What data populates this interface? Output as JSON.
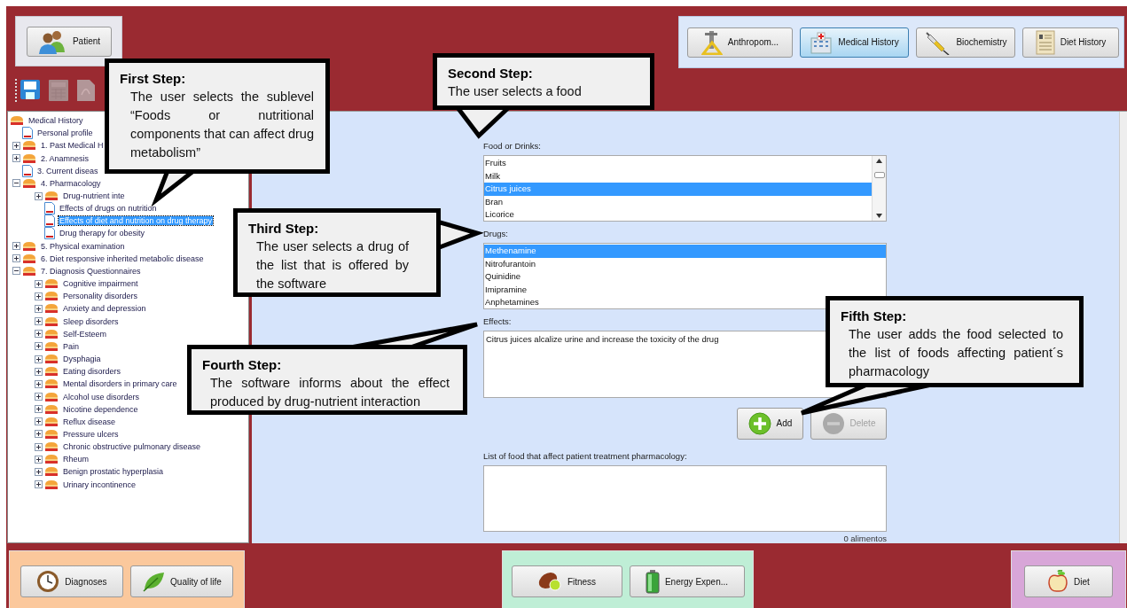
{
  "patient_panel": {
    "button": {
      "label": "Patient",
      "kind": "people"
    }
  },
  "toolbar": [
    {
      "kind": "save",
      "disabled": false
    },
    {
      "kind": "calculator",
      "disabled": true
    },
    {
      "kind": "pdf",
      "disabled": true
    }
  ],
  "nav_tabs": [
    {
      "label": "Anthropom...",
      "kind": "caliper",
      "selected": false
    },
    {
      "label": "Medical History",
      "kind": "hospital",
      "selected": true
    },
    {
      "label": "Biochemistry",
      "kind": "syringe",
      "selected": false
    },
    {
      "label": "Diet History",
      "kind": "document",
      "selected": false
    }
  ],
  "tree": {
    "label": "Medical History",
    "kind": "folder",
    "selected": false,
    "children": [
      {
        "label": "Personal profile",
        "kind": "doc",
        "selected": false
      },
      {
        "label": "1. Past Medical H",
        "kind": "folder",
        "expanded": false,
        "selected": false
      },
      {
        "label": "2. Anamnesis",
        "kind": "folder",
        "expanded": false,
        "selected": false
      },
      {
        "label": "3. Current diseas",
        "kind": "doc",
        "selected": false
      },
      {
        "label": "4. Pharmacology",
        "kind": "folder",
        "expanded": true,
        "selected": false,
        "children": [
          {
            "label": "Drug-nutrient inte",
            "kind": "folder",
            "expanded": false,
            "selected": false
          },
          {
            "label": "Effects of drugs on nutrition",
            "kind": "doc",
            "selected": false
          },
          {
            "label": "Effects of diet and nutrition on drug therapy",
            "kind": "doc",
            "selected": true
          },
          {
            "label": "Drug therapy for obesity",
            "kind": "doc",
            "selected": false
          }
        ]
      },
      {
        "label": "5. Physical examination",
        "kind": "folder",
        "expanded": false,
        "selected": false
      },
      {
        "label": "6. Diet responsive inherited metabolic disease",
        "kind": "folder",
        "expanded": false,
        "selected": false
      },
      {
        "label": "7. Diagnosis Questionnaires",
        "kind": "folder",
        "expanded": true,
        "selected": false,
        "children": [
          {
            "label": "Cognitive impairment",
            "kind": "folder",
            "expanded": false,
            "selected": false
          },
          {
            "label": "Personality disorders",
            "kind": "folder",
            "expanded": false,
            "selected": false
          },
          {
            "label": "Anxiety and depression",
            "kind": "folder",
            "expanded": false,
            "selected": false
          },
          {
            "label": "Sleep disorders",
            "kind": "folder",
            "expanded": false,
            "selected": false
          },
          {
            "label": "Self-Esteem",
            "kind": "folder",
            "expanded": false,
            "selected": false
          },
          {
            "label": "Pain",
            "kind": "folder",
            "expanded": false,
            "selected": false
          },
          {
            "label": "Dysphagia",
            "kind": "folder",
            "expanded": false,
            "selected": false
          },
          {
            "label": "Eating disorders",
            "kind": "folder",
            "expanded": false,
            "selected": false
          },
          {
            "label": "Mental disorders in primary care",
            "kind": "folder",
            "expanded": false,
            "selected": false
          },
          {
            "label": "Alcohol use disorders",
            "kind": "folder",
            "expanded": false,
            "selected": false
          },
          {
            "label": "Nicotine dependence",
            "kind": "folder",
            "expanded": false,
            "selected": false
          },
          {
            "label": "Reflux disease",
            "kind": "folder",
            "expanded": false,
            "selected": false
          },
          {
            "label": "Pressure ulcers",
            "kind": "folder",
            "expanded": false,
            "selected": false
          },
          {
            "label": "Chronic obstructive pulmonary disease",
            "kind": "folder",
            "expanded": false,
            "selected": false
          },
          {
            "label": "Rheum",
            "kind": "folder",
            "expanded": false,
            "selected": false
          },
          {
            "label": "Benign prostatic hyperplasia",
            "kind": "folder",
            "expanded": false,
            "selected": false
          },
          {
            "label": "Urinary incontinence",
            "kind": "folder",
            "expanded": false,
            "selected": false
          }
        ]
      }
    ]
  },
  "form": {
    "food_label": "Food or Drinks:",
    "foods": [
      {
        "label": "Fruits",
        "selected": false
      },
      {
        "label": "Milk",
        "selected": false
      },
      {
        "label": "Citrus juices",
        "selected": true
      },
      {
        "label": "Bran",
        "selected": false
      },
      {
        "label": "Licorice",
        "selected": false
      }
    ],
    "drugs_label": "Drugs:",
    "drugs": [
      {
        "label": "Methenamine",
        "selected": true
      },
      {
        "label": "Nitrofurantoin",
        "selected": false
      },
      {
        "label": "Quinidine",
        "selected": false
      },
      {
        "label": "Imipramine",
        "selected": false
      },
      {
        "label": "Anphetamines",
        "selected": false
      }
    ],
    "effects_label": "Effects:",
    "effects": "Citrus juices alcalize urine and increase the toxicity of the drug",
    "buttons": [
      {
        "label": "Add",
        "kind": "add",
        "disabled": false
      },
      {
        "label": "Delete",
        "kind": "delete",
        "disabled": true
      }
    ],
    "list_label": "List of food that affect patient treatment pharmacology:",
    "count": "0 alimentos"
  },
  "bottom_groups": [
    {
      "color": "#fbc89c",
      "buttons": [
        {
          "label": "Diagnoses",
          "kind": "clock"
        },
        {
          "label": "Quality of life",
          "kind": "leaf"
        }
      ]
    },
    {
      "color": "#bfeed6",
      "buttons": [
        {
          "label": "Fitness",
          "kind": "football"
        },
        {
          "label": "Energy Expen...",
          "kind": "battery"
        }
      ]
    },
    {
      "color": "#d8a6d8",
      "buttons": [
        {
          "label": "Diet",
          "kind": "apple"
        }
      ]
    }
  ],
  "callouts": [
    {
      "title": "First Step:",
      "text": "The user selects the sublevel “Foods or nutritional components that can affect drug metabolism”"
    },
    {
      "title": "Second Step:",
      "text": "The user selects a food"
    },
    {
      "title": "Third Step:",
      "text": "The user selects a drug of the list that is offered by the software"
    },
    {
      "title": "Fourth Step:",
      "text": "The software informs about the effect produced by drug-nutrient interaction"
    },
    {
      "title": "Fifth Step:",
      "text": "The user adds the food selected to the list of foods affecting patient´s pharmacology"
    }
  ]
}
